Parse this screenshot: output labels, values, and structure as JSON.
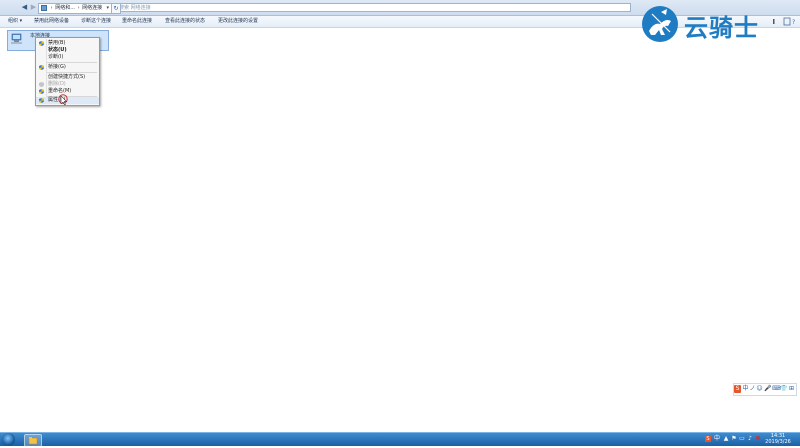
{
  "address_bar": {
    "crumb_1": "网络和...",
    "crumb_2": "网络连接",
    "search_placeholder": "搜索 网络连接"
  },
  "toolbar": {
    "items": [
      "组织 ▾",
      "禁用此网络设备",
      "诊断这个连接",
      "重命名此连接",
      "查看此连接的状态",
      "更改此连接的设置"
    ]
  },
  "selected_item": {
    "title": "本地连接"
  },
  "context_menu": {
    "items": [
      {
        "label": "禁用(B)",
        "icon": "shield-icon",
        "style": "normal"
      },
      {
        "label": "状态(U)",
        "icon": "",
        "style": "bold"
      },
      {
        "label": "诊断(I)",
        "icon": "",
        "style": "normal"
      },
      {
        "label": "桥接(G)",
        "icon": "shield-icon",
        "style": "normal"
      },
      {
        "label": "创建快捷方式(S)",
        "icon": "",
        "style": "normal"
      },
      {
        "label": "删除(D)",
        "icon": "shield-icon",
        "style": "disabled"
      },
      {
        "label": "重命名(M)",
        "icon": "shield-icon",
        "style": "normal"
      },
      {
        "label": "属性(R)",
        "icon": "shield-icon",
        "style": "normal"
      }
    ]
  },
  "logo": {
    "text": "云骑士"
  },
  "ime_bar": {
    "items": [
      "S",
      "中",
      "ノ",
      "☺",
      "🎤",
      "⌨",
      "👕",
      "⊞"
    ]
  },
  "clock": {
    "time": "14:31",
    "date": "2019/3/26"
  },
  "colors": {
    "accent": "#1f7bc2",
    "selection": "#cfe4fa",
    "taskbar": "#1c5fa4",
    "ime_logo": "#e4572e"
  }
}
